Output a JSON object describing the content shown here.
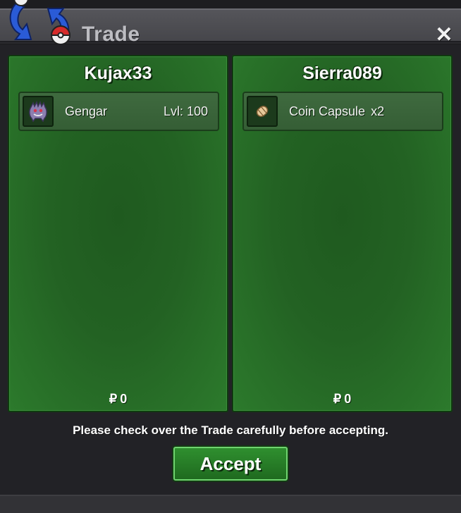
{
  "window": {
    "title": "Trade",
    "close_symbol": "✕"
  },
  "icons": {
    "logo": "trade-arrows-pokeball-icon",
    "close": "close-icon",
    "gengar": "gengar-icon",
    "coin_capsule": "coin-capsule-icon"
  },
  "left_panel": {
    "player_name": "Kujax33",
    "item": {
      "name": "Gengar",
      "level": "Lvl: 100"
    },
    "money_symbol": "₽",
    "money": "0"
  },
  "right_panel": {
    "player_name": "Sierra089",
    "item": {
      "name": "Coin Capsule",
      "quantity": "x2"
    },
    "money_symbol": "₽",
    "money": "0"
  },
  "footer": {
    "notice": "Please check over the Trade carefully before accepting.",
    "accept_label": "Accept"
  },
  "colors": {
    "panel_green": "#236223",
    "accent_green": "#6fd46f",
    "titlebar": "#4e4e53"
  }
}
